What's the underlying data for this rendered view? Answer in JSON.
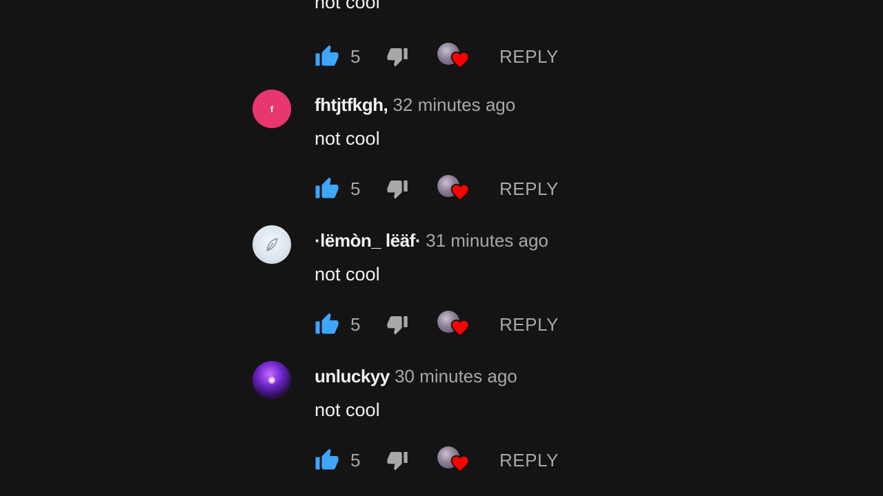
{
  "top_comment": {
    "text": "not cool",
    "likes": "5",
    "reply_label": "REPLY"
  },
  "comments": [
    {
      "avatar_letter": "f",
      "author": "fhtjtfkgh,",
      "time": "32 minutes ago",
      "text": "not cool",
      "likes": "5",
      "reply_label": "REPLY"
    },
    {
      "avatar_letter": "",
      "author": "·lëmòn_ lëäf·",
      "time": "31 minutes ago",
      "text": "not cool",
      "likes": "5",
      "reply_label": "REPLY"
    },
    {
      "avatar_letter": "",
      "author": "unluckyy",
      "time": "30 minutes ago",
      "text": "not cool",
      "likes": "5",
      "reply_label": "REPLY"
    }
  ],
  "icons": {
    "like": "thumbs-up-icon",
    "dislike": "thumbs-down-icon",
    "creator_heart": "creator-heart-icon"
  },
  "colors": {
    "background": "#141414",
    "like_blue": "#3ea6ff",
    "text_primary": "#f1f1f1",
    "text_secondary": "#a8a8a8",
    "heart_red": "#ff0000",
    "avatar_pink": "#e8366f"
  }
}
